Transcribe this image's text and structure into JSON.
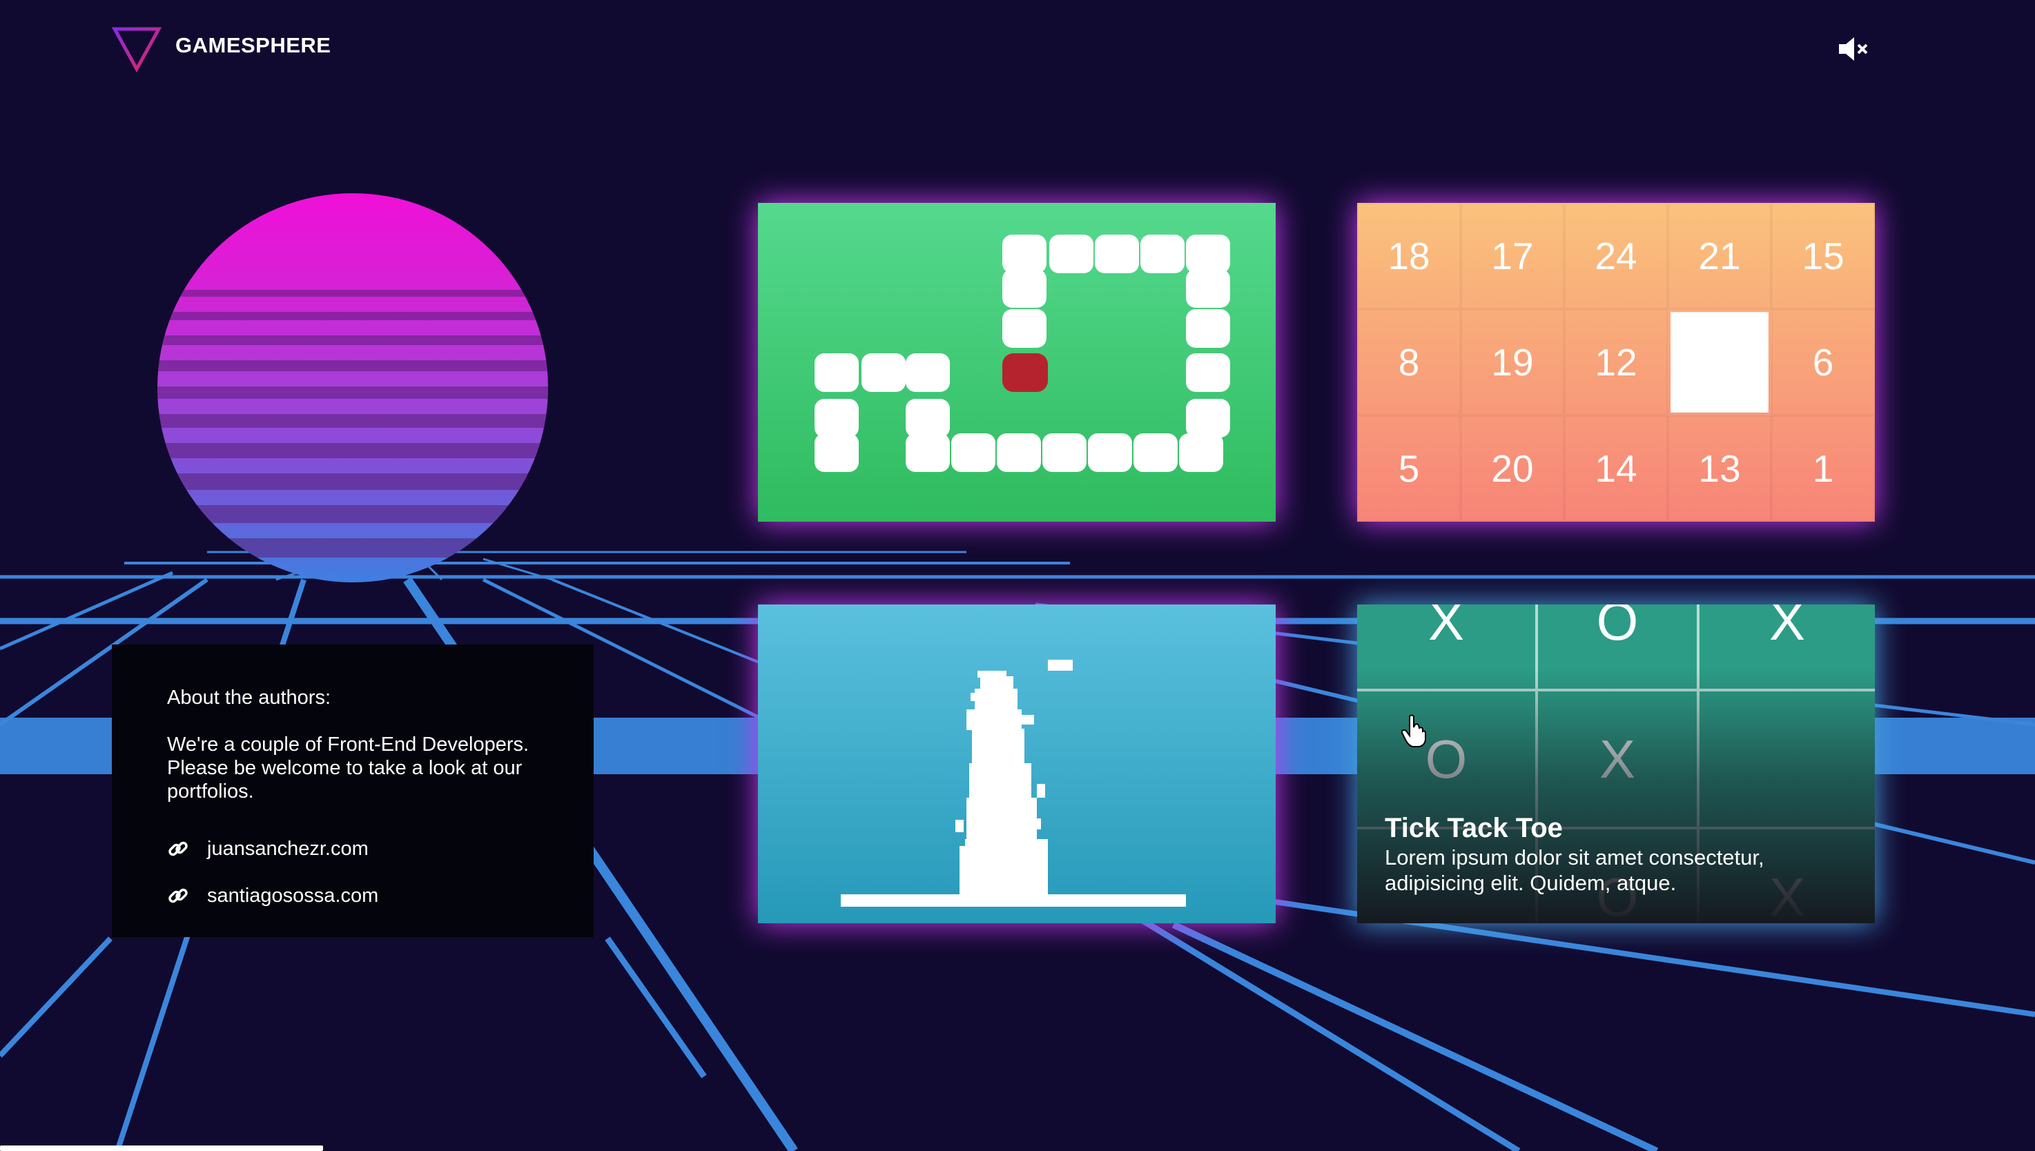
{
  "header": {
    "brand": "GAMESPHERE",
    "logo_icon": "triangle-logo-icon",
    "sound_icon": "speaker-muted-icon"
  },
  "about": {
    "title": "About the authors:",
    "description": "We're a couple of Front-End Developers. Please be welcome to take a look at our portfolios.",
    "links": [
      {
        "icon": "link-icon",
        "text": "juansanchezr.com"
      },
      {
        "icon": "link-icon",
        "text": "santiagosossa.com"
      }
    ]
  },
  "puzzle": {
    "tiles": [
      "18",
      "17",
      "24",
      "21",
      "15",
      "8",
      "19",
      "12",
      "",
      "6",
      "5",
      "20",
      "14",
      "13",
      "1"
    ]
  },
  "tictactoe": {
    "title": "Tick Tack Toe",
    "description": "Lorem ipsum dolor sit amet consectetur, adipisicing elit. Quidem, atque.",
    "cells": [
      "X",
      "O",
      "X",
      "O",
      "X",
      "",
      "",
      "O",
      "X"
    ]
  },
  "colors": {
    "background": "#110a30",
    "grid_line": "#3a86dc",
    "snake_card": "#3fc872",
    "puzzle_card": "#f9a47a",
    "tower_card": "#3aaccb",
    "ttt_card": "#2c9c86",
    "glow": "#c73cf0"
  }
}
